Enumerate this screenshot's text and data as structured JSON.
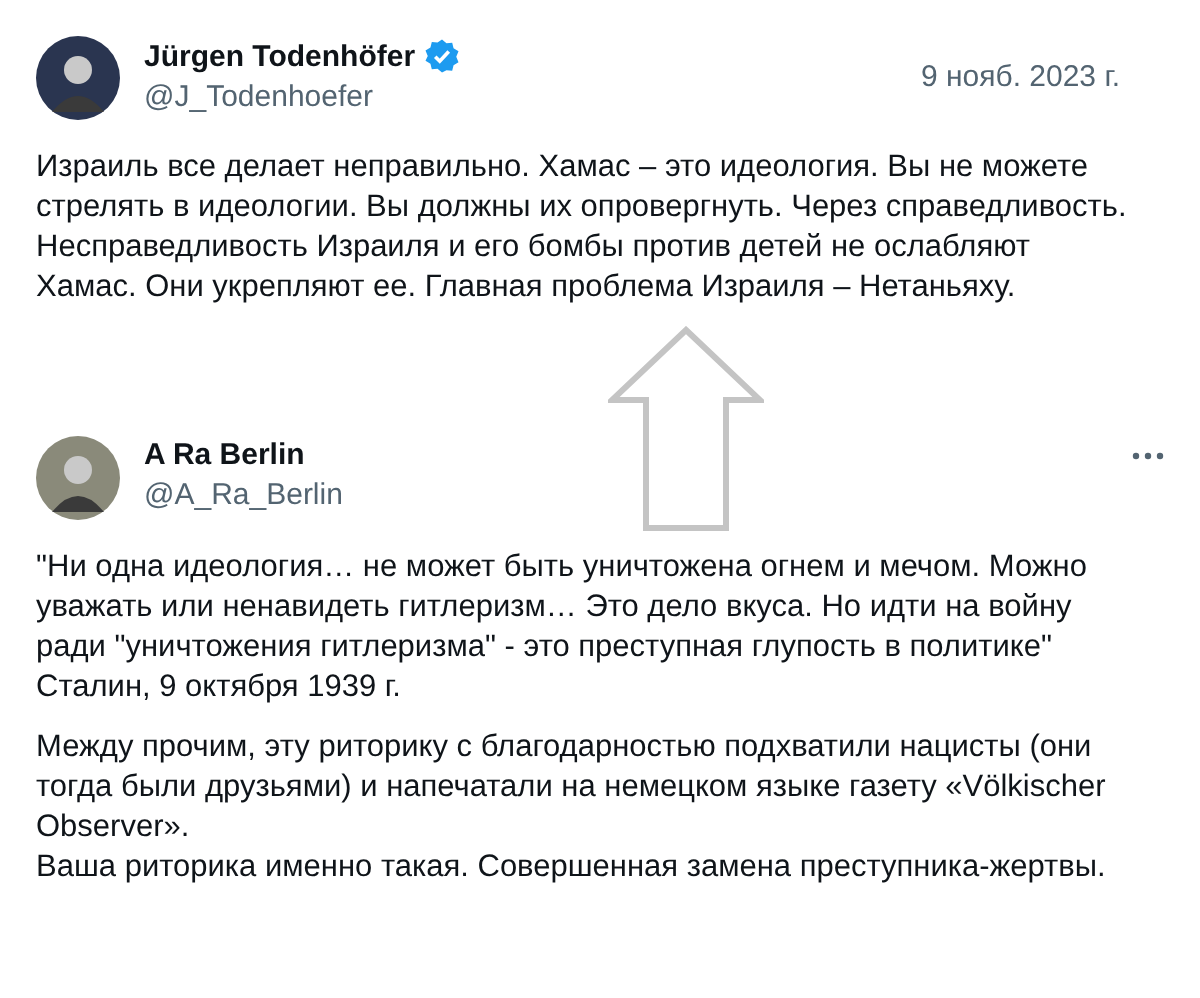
{
  "tweets": [
    {
      "name": "Jürgen Todenhöfer",
      "verified": true,
      "handle": "@J_Todenhoefer",
      "date": "9 нояб. 2023 г.",
      "more_menu": false,
      "paragraphs": [
        "Израиль все делает неправильно. Хамас – это идеология. Вы не можете стрелять в идеологии. Вы должны их опровергнуть. Через справедливость. Несправедливость Израиля и его бомбы против детей не ослабляют Хамас. Они укрепляют ее. Главная проблема Израиля – Нетаньяху."
      ]
    },
    {
      "name": "A Ra Berlin",
      "verified": false,
      "handle": "@A_Ra_Berlin",
      "more_menu": true,
      "paragraphs": [
        "\"Ни одна идеология… не может быть уничтожена огнем и мечом. Можно уважать или ненавидеть гитлеризм… Это дело вкуса. Но идти на войну ради \"уничтожения гитлеризма\" - это преступная глупость в политике\"\nСталин, 9 октября 1939 г.",
        "Между прочим, эту риторику с благодарностью подхватили нацисты (они тогда были друзьями) и напечатали на немецком языке газету «Völkischer Observer».\nВаша риторика именно такая. Совершенная замена преступника-жертвы."
      ]
    }
  ],
  "annotation": {
    "kind": "up-arrow"
  }
}
